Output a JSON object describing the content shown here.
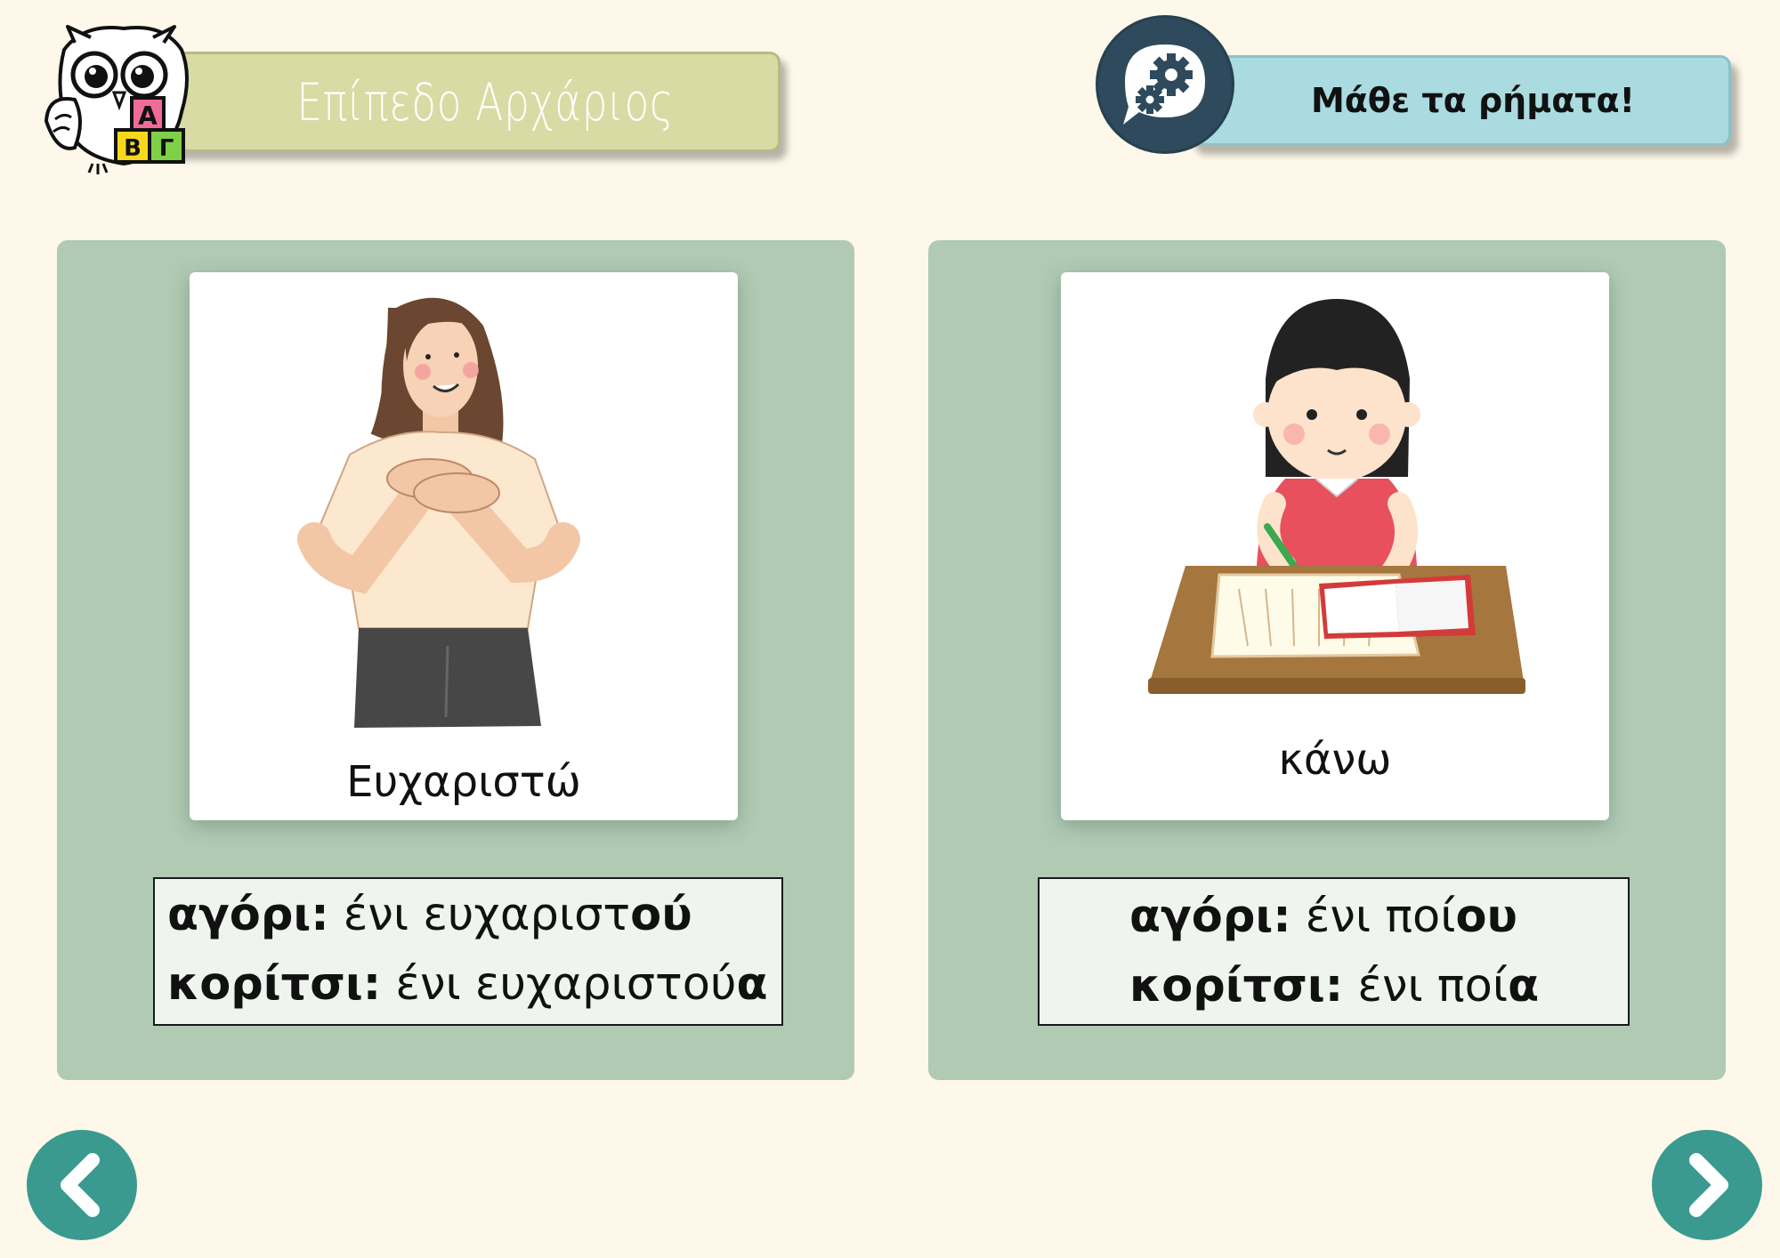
{
  "header": {
    "level_title": "Επίπεδο Αρχάριος",
    "verbs_button_label": "Μάθε τα ρήματα!",
    "logo_letters": [
      "Α",
      "Β",
      "Γ"
    ]
  },
  "cards": [
    {
      "word": "Ευχαριστώ",
      "illustration": "woman-hands-on-heart",
      "boy_label": "αγόρι:",
      "boy_text": " ένι ευχαριστ",
      "boy_ending": "ού",
      "girl_label": "κορίτσι:",
      "girl_text": " ένι ευχαριστού",
      "girl_ending": "α"
    },
    {
      "word": "κάνω",
      "illustration": "girl-writing-at-desk",
      "boy_label": "αγόρι:",
      "boy_text": " ένι ποί",
      "boy_ending": "ου",
      "girl_label": "κορίτσι:",
      "girl_text": " ένι ποί",
      "girl_ending": "α"
    }
  ],
  "nav": {
    "prev_icon": "chevron-left-icon",
    "next_icon": "chevron-right-icon"
  },
  "colors": {
    "background": "#fdf8ea",
    "panel": "#b0cab4",
    "level_banner": "#d9dba4",
    "verbs_banner": "#a9dbe0",
    "gear_badge": "#2f4a5c",
    "nav_button": "#3a9a8f"
  }
}
